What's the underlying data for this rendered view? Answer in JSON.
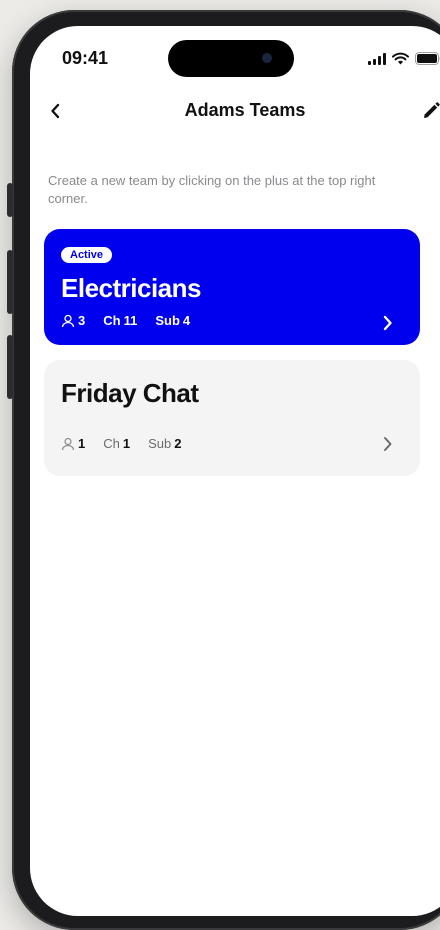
{
  "status_bar": {
    "time": "09:41"
  },
  "nav": {
    "title": "Adams Teams"
  },
  "hint": "Create a new team by clicking on the plus at the top right corner.",
  "teams": [
    {
      "badge": "Active",
      "name": "Electricians",
      "members": "3",
      "channels_label": "Ch",
      "channels": "11",
      "subs_label": "Sub",
      "subs": "4",
      "active": true
    },
    {
      "name": "Friday Chat",
      "members": "1",
      "channels_label": "Ch",
      "channels": "1",
      "subs_label": "Sub",
      "subs": "2",
      "active": false
    }
  ],
  "colors": {
    "accent": "#0000ee",
    "card_inactive": "#f4f4f4",
    "muted_text": "#8a8a8e"
  },
  "icons": [
    "back-chevron-icon",
    "pencil-icon",
    "person-icon",
    "chevron-right-icon",
    "signal-icon",
    "wifi-icon",
    "battery-icon"
  ]
}
